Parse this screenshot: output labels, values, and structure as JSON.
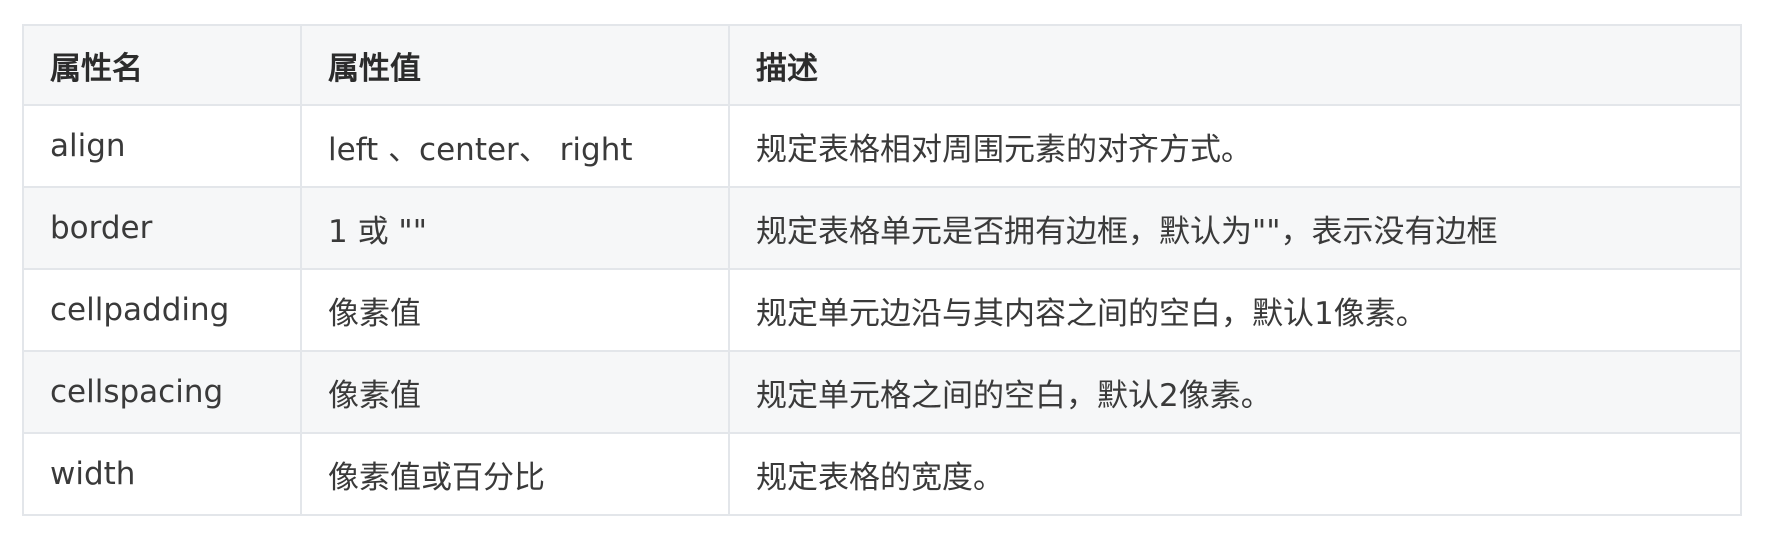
{
  "table": {
    "headers": [
      "属性名",
      "属性值",
      "描述"
    ],
    "rows": [
      [
        "align",
        "left 、center、 right",
        "规定表格相对周围元素的对齐方式。"
      ],
      [
        "border",
        "1 或 \"\"",
        "规定表格单元是否拥有边框，默认为\"\"，表示没有边框"
      ],
      [
        "cellpadding",
        "像素值",
        "规定单元边沿与其内容之间的空白，默认1像素。"
      ],
      [
        "cellspacing",
        "像素值",
        "规定单元格之间的空白，默认2像素。"
      ],
      [
        "width",
        "像素值或百分比",
        "规定表格的宽度。"
      ]
    ]
  }
}
